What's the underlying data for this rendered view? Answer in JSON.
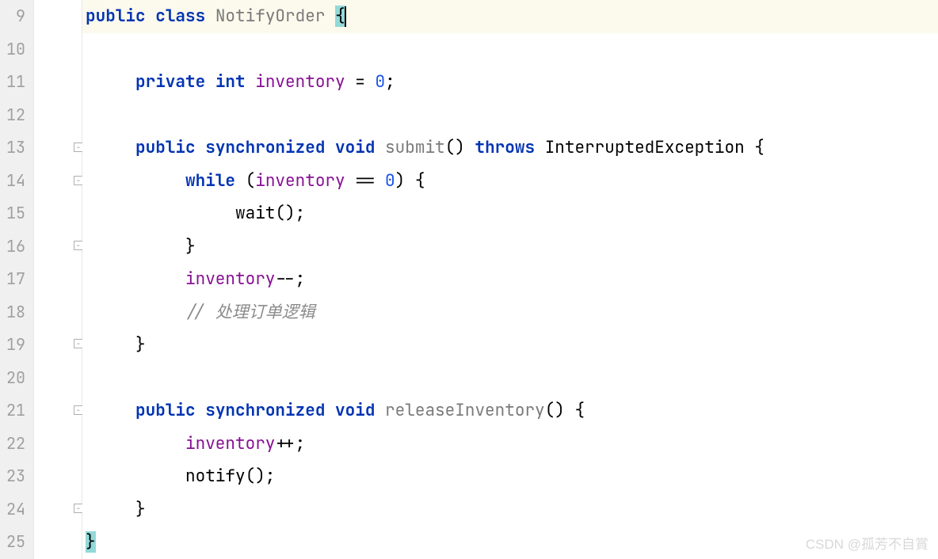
{
  "lineNumbers": [
    "9",
    "10",
    "11",
    "12",
    "13",
    "14",
    "15",
    "16",
    "17",
    "18",
    "19",
    "20",
    "21",
    "22",
    "23",
    "24",
    "25"
  ],
  "code": {
    "l9": {
      "kw_public": "public",
      "kw_class": "class",
      "class_name": "NotifyOrder",
      "brace": "{"
    },
    "l11": {
      "kw_private": "private",
      "kw_int": "int",
      "field": "inventory",
      "eq": "=",
      "zero": "0",
      "semi": ";"
    },
    "l13": {
      "kw_public": "public",
      "kw_sync": "synchronized",
      "kw_void": "void",
      "method": "submit",
      "parens": "()",
      "kw_throws": "throws",
      "exc": "InterruptedException",
      "brace": "{"
    },
    "l14": {
      "kw_while": "while",
      "open": "(",
      "field": "inventory",
      "eqeq": "==",
      "zero": "0",
      "close": ")",
      "brace": "{"
    },
    "l15": {
      "call": "wait();"
    },
    "l16": {
      "brace": "}"
    },
    "l17": {
      "field": "inventory",
      "dec": "--;"
    },
    "l18": {
      "comment": "// 处理订单逻辑"
    },
    "l19": {
      "brace": "}"
    },
    "l21": {
      "kw_public": "public",
      "kw_sync": "synchronized",
      "kw_void": "void",
      "method": "releaseInventory",
      "parens": "()",
      "brace": "{"
    },
    "l22": {
      "field": "inventory",
      "inc": "++;"
    },
    "l23": {
      "call": "notify();"
    },
    "l24": {
      "brace": "}"
    },
    "l25": {
      "brace": "}"
    }
  },
  "watermark": "CSDN @孤芳不自賞"
}
